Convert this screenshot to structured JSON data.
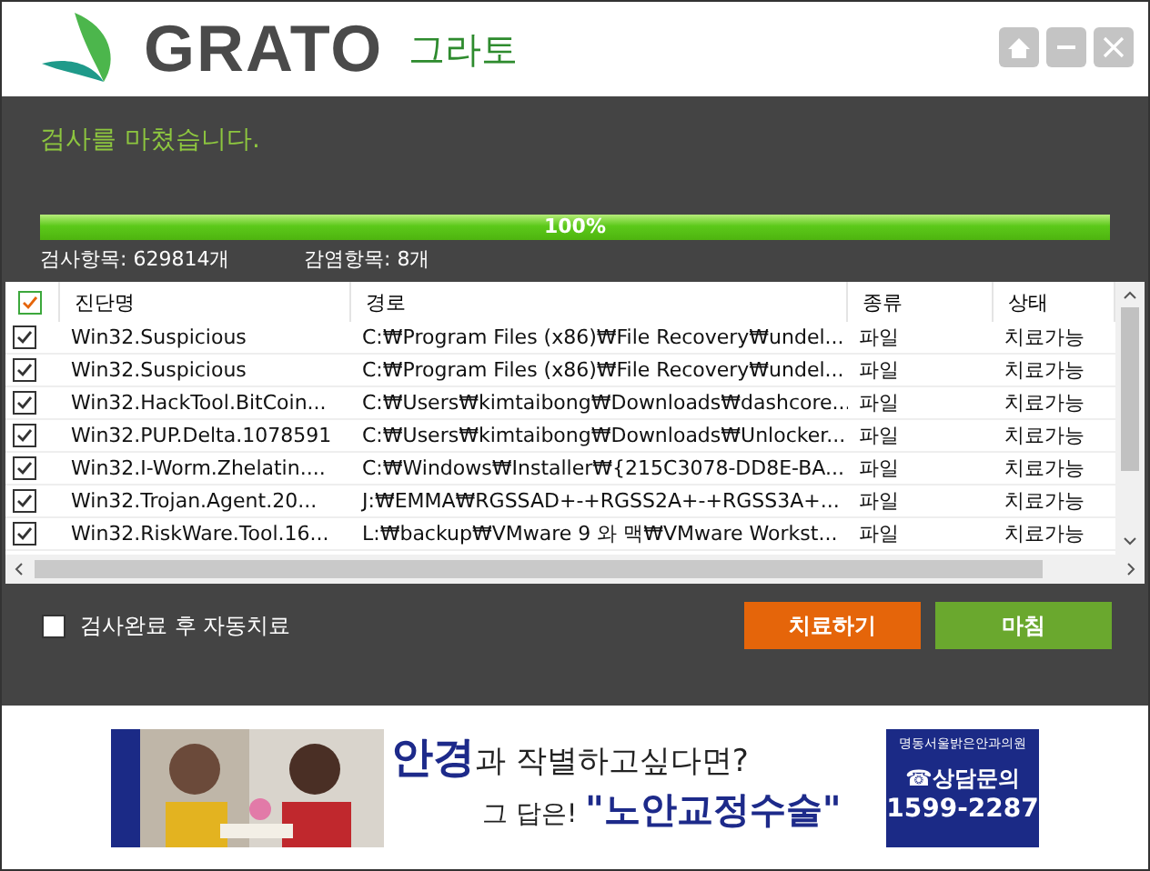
{
  "header": {
    "logo_text": "GRATO",
    "logo_sub": "그라토"
  },
  "status_message": "검사를 마쳤습니다.",
  "progress": {
    "level": 1,
    "reading": "100%"
  },
  "stats": [
    {
      "label": "검사항목:",
      "value": "629814개"
    },
    {
      "label": "감염항목:",
      "value": "8개"
    }
  ],
  "table": {
    "select_all": {
      "checked": true
    },
    "columns": [
      "진단명",
      "경로",
      "종류",
      "상태"
    ],
    "rows": [
      {
        "checked": true,
        "cells": [
          "Win32.Suspicious",
          "C:₩Program Files (x86)₩File Recovery₩undel...",
          "파일",
          "치료가능"
        ]
      },
      {
        "checked": true,
        "cells": [
          "Win32.Suspicious",
          "C:₩Program Files (x86)₩File Recovery₩undel...",
          "파일",
          "치료가능"
        ]
      },
      {
        "checked": true,
        "cells": [
          "Win32.HackTool.BitCoin...",
          "C:₩Users₩kimtaibong₩Downloads₩dashcore...",
          "파일",
          "치료가능"
        ]
      },
      {
        "checked": true,
        "cells": [
          "Win32.PUP.Delta.1078591",
          "C:₩Users₩kimtaibong₩Downloads₩Unlocker...",
          "파일",
          "치료가능"
        ]
      },
      {
        "checked": true,
        "cells": [
          "Win32.I-Worm.Zhelatin....",
          "C:₩Windows₩Installer₩{215C3078-DD8E-BA...",
          "파일",
          "치료가능"
        ]
      },
      {
        "checked": true,
        "cells": [
          "Win32.Trojan.Agent.20...",
          "J:₩EMMA₩RGSSAD+-+RGSS2A+-+RGSS3A+...",
          "파일",
          "치료가능"
        ]
      },
      {
        "checked": true,
        "cells": [
          "Win32.RiskWare.Tool.16...",
          "L:₩backup₩VMware 9 와 맥₩VMware Workst...",
          "파일",
          "치료가능"
        ]
      }
    ]
  },
  "auto_treat": {
    "label": "검사완료 후 자동치료",
    "checked": false
  },
  "buttons": [
    {
      "label": "치료하기",
      "kind": "primary"
    },
    {
      "label": "마침",
      "kind": "finish"
    }
  ],
  "banner": {
    "headline": "**안경**과 작별하고싶다면?",
    "answer": "그 답은! **\"노안교정수술\"**",
    "clinic": "명동서울밝은안과의원",
    "phone_label": "☎상담문의",
    "phone": "1599-2287"
  }
}
